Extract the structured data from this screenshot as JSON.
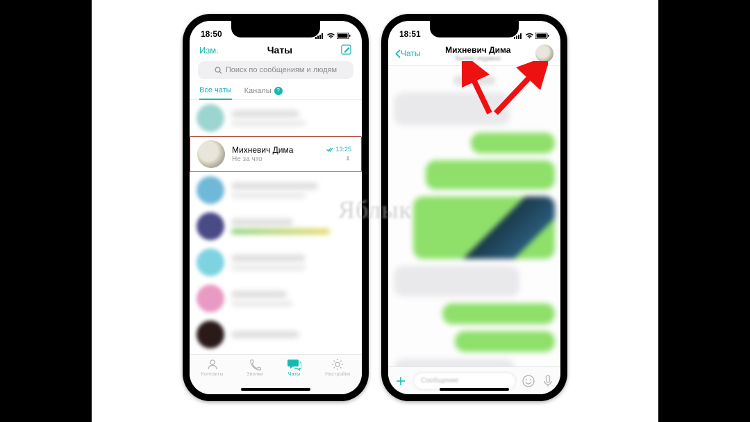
{
  "watermark": "Яблык",
  "left": {
    "time": "18:50",
    "nav": {
      "edit": "Изм.",
      "title": "Чаты"
    },
    "search_placeholder": "Поиск по сообщениям и людям",
    "tabs": {
      "all": "Все чаты",
      "channels": "Каналы",
      "channels_badge": "?"
    },
    "highlighted_chat": {
      "name": "Михневич Дима",
      "subtitle": "Не за что",
      "time": "13:25"
    },
    "tabbar": {
      "contacts": "Контакты",
      "calls": "Звонки",
      "chats": "Чаты",
      "settings": "Настройки"
    }
  },
  "right": {
    "time": "18:51",
    "back": "Чаты",
    "name": "Михневич Дима",
    "status": "был(а) недавно",
    "input_placeholder": "Сообщение"
  }
}
